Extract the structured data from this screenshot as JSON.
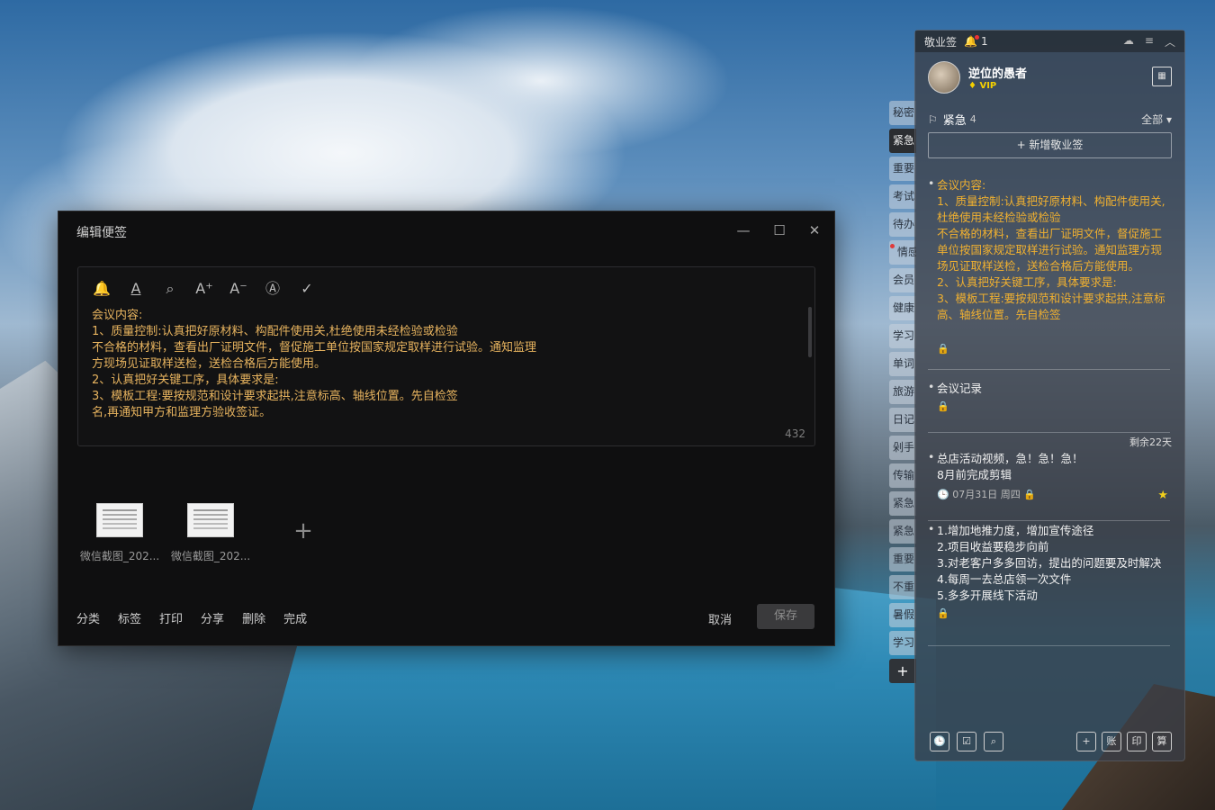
{
  "editor": {
    "title": "编辑便签",
    "window_controls": {
      "minimize": "—",
      "maximize": "☐",
      "close": "✕"
    },
    "toolbar": [
      {
        "name": "bell-icon",
        "glyph": "🔔"
      },
      {
        "name": "text-color-icon",
        "glyph": "A"
      },
      {
        "name": "search-icon",
        "glyph": "⌕"
      },
      {
        "name": "font-larger-icon",
        "glyph": "A⁺"
      },
      {
        "name": "font-smaller-icon",
        "glyph": "A⁻"
      },
      {
        "name": "auto-format-icon",
        "glyph": "Ⓐ"
      },
      {
        "name": "check-icon",
        "glyph": "✓"
      }
    ],
    "content": "会议内容:\n1、质量控制:认真把好原材料、构配件使用关,杜绝使用未经检验或检验\n不合格的材料，查看出厂证明文件，督促施工单位按国家规定取样进行试验。通知监理\n方现场见证取样送检，送检合格后方能使用。\n2、认真把好关键工序，具体要求是:\n3、模板工程:要按规范和设计要求起拱,注意标高、轴线位置。先自检签\n名,再通知甲方和监理方验收签证。",
    "char_count": "432",
    "attachments": [
      {
        "filename": "微信截图_202..."
      },
      {
        "filename": "微信截图_202..."
      }
    ],
    "add_attachment": "+",
    "footer_links": [
      "分类",
      "标签",
      "打印",
      "分享",
      "删除",
      "完成"
    ],
    "cancel_label": "取消",
    "save_label": "保存"
  },
  "side_tabs": [
    {
      "label": "秘密",
      "active": false
    },
    {
      "label": "紧急",
      "active": true
    },
    {
      "label": "重要",
      "active": false
    },
    {
      "label": "考试",
      "active": false
    },
    {
      "label": "待办",
      "active": false
    },
    {
      "label": "情感",
      "active": false,
      "dot": true
    },
    {
      "label": "会员",
      "active": false
    },
    {
      "label": "健康",
      "active": false
    },
    {
      "label": "学习",
      "active": false
    },
    {
      "label": "单词",
      "active": false
    },
    {
      "label": "旅游",
      "active": false
    },
    {
      "label": "日记",
      "active": false
    },
    {
      "label": "剁手",
      "active": false
    },
    {
      "label": "传输",
      "active": false
    },
    {
      "label": "紧急",
      "active": false
    },
    {
      "label": "紧急",
      "active": false
    },
    {
      "label": "重要",
      "active": false
    },
    {
      "label": "不重",
      "active": false
    },
    {
      "label": "暑假",
      "active": false
    },
    {
      "label": "学习",
      "active": false
    }
  ],
  "side_tabs_add": "+",
  "panel": {
    "app_name": "敬业签",
    "notification_count": "1",
    "user": {
      "name": "逆位的愚者",
      "vip": "VIP"
    },
    "category": {
      "name": "紧急",
      "count": "4",
      "filter": "全部 ▾"
    },
    "new_note_label": "+ 新增敬业签",
    "notes": [
      {
        "text": "会议内容:\n1、质量控制:认真把好原材料、构配件使用关,杜绝使用未经检验或检验\n不合格的材料，查看出厂证明文件，督促施工单位按国家规定取样进行试验。通知监理方现场见证取样送检，送检合格后方能使用。\n2、认真把好关键工序，具体要求是:\n3、模板工程:要按规范和设计要求起拱,注意标高、轴线位置。先自检签",
        "color": "#f0b030"
      },
      {
        "text": "会议记录",
        "color": "#ffffff"
      },
      {
        "text": "总店活动视频，急！急！急！\n8月前完成剪辑",
        "color": "#ffffff",
        "date": "07月31日 周四",
        "remaining": "剩余22天"
      },
      {
        "text": "1.增加地推力度，增加宣传途径\n2.项目收益要稳步向前\n3.对老客户多多回访，提出的问题要及时解决\n4.每周一去总店领一次文件\n5.多多开展线下活动",
        "color": "#ffffff"
      }
    ],
    "bottom_icons_left": [
      "🕒",
      "☑",
      "⌕"
    ],
    "bottom_icons_right": [
      "+",
      "账",
      "印",
      "算"
    ]
  }
}
